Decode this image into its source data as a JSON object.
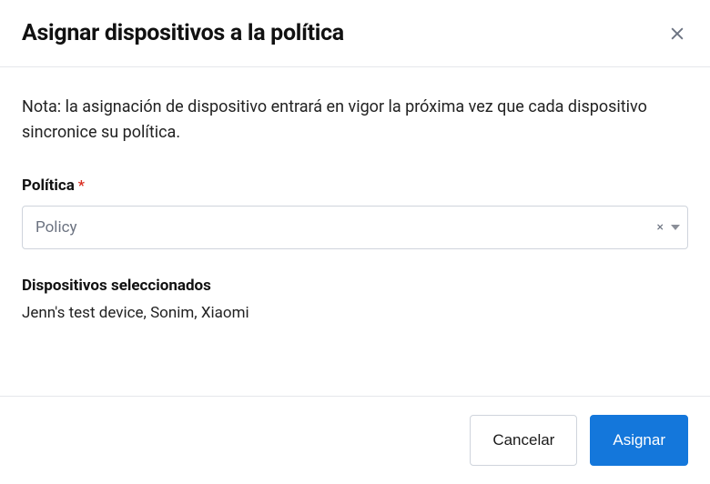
{
  "header": {
    "title": "Asignar dispositivos a la política"
  },
  "body": {
    "note": "Nota: la asignación de dispositivo entrará en vigor la próxima vez que cada dispositivo sincronice su política.",
    "policy_label": "Política",
    "required_mark": "*",
    "policy_select": {
      "value": "Policy"
    },
    "selected_devices_label": "Dispositivos seleccionados",
    "selected_devices": "Jenn's test device, Sonim, Xiaomi"
  },
  "footer": {
    "cancel_label": "Cancelar",
    "assign_label": "Asignar"
  }
}
